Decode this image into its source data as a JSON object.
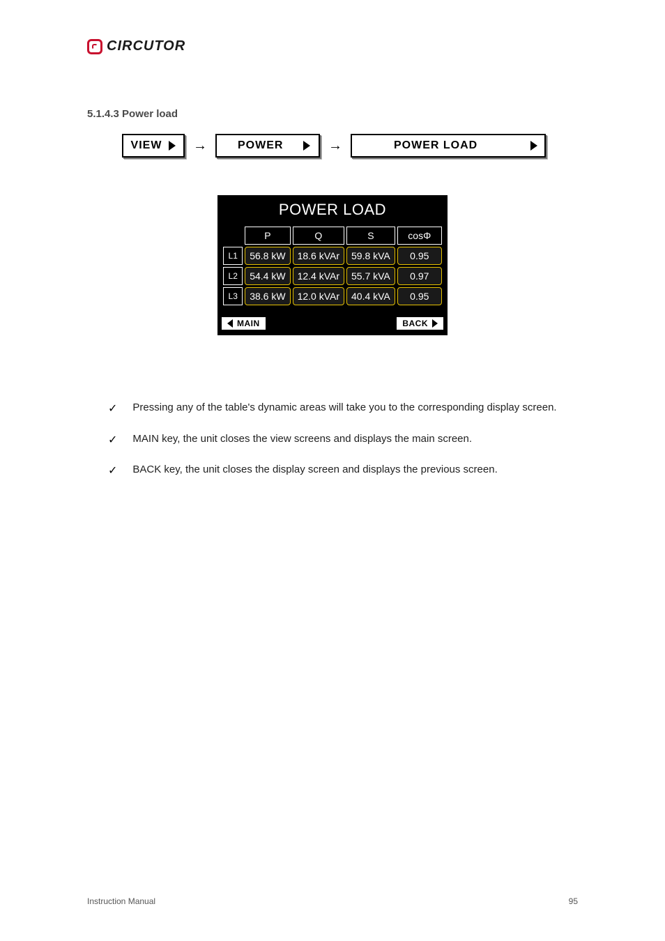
{
  "brand": "CIRCUTOR",
  "section_heading": "5.1.4.3 Power load",
  "crumbs": {
    "view": "VIEW",
    "power": "POWER",
    "load": "POWER LOAD",
    "arrow": "→"
  },
  "device": {
    "title": "POWER LOAD",
    "columns": [
      "P",
      "Q",
      "S",
      "cosΦ"
    ],
    "rows": [
      {
        "label": "L1",
        "values": [
          "56.8 kW",
          "18.6 kVAr",
          "59.8 kVA",
          "0.95"
        ]
      },
      {
        "label": "L2",
        "values": [
          "54.4 kW",
          "12.4 kVAr",
          "55.7 kVA",
          "0.97"
        ]
      },
      {
        "label": "L3",
        "values": [
          "38.6 kW",
          "12.0 kVAr",
          "40.4 kVA",
          "0.95"
        ]
      }
    ],
    "footer": {
      "main": "MAIN",
      "back": "BACK"
    }
  },
  "bullets": [
    "Pressing any of the table's dynamic areas will take you to the corresponding display screen.",
    "MAIN key, the unit closes the view screens and displays the main screen.",
    "BACK key, the unit closes the display screen and displays the previous screen."
  ],
  "footer": {
    "left": "Instruction Manual",
    "right": "95"
  }
}
